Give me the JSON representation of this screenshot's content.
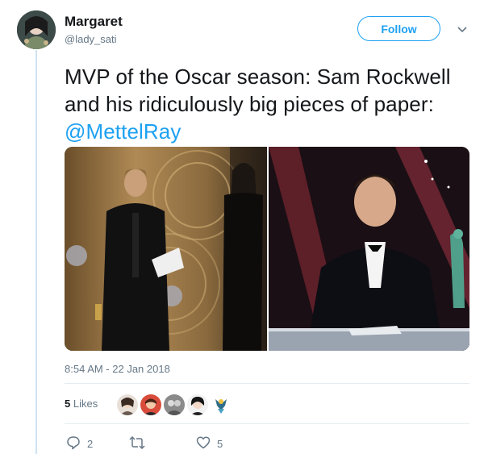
{
  "user": {
    "name": "Margaret",
    "handle": "@lady_sati"
  },
  "follow_label": "Follow",
  "tweet": {
    "text": "MVP of the Oscar season: Sam Rockwell and his ridiculously big pieces of paper: ",
    "mention": "@MettelRay"
  },
  "timestamp": "8:54 AM - 22 Jan 2018",
  "likes": {
    "count": "5",
    "label": "Likes"
  },
  "actions": {
    "replies": "2",
    "retweets": "",
    "likes": "5"
  },
  "icons": {
    "caret": "chevron-down-icon",
    "reply": "reply-icon",
    "retweet": "retweet-icon",
    "like": "heart-icon"
  },
  "colors": {
    "accent": "#1da1f2",
    "muted": "#657786",
    "thread": "#cfe3f3"
  }
}
